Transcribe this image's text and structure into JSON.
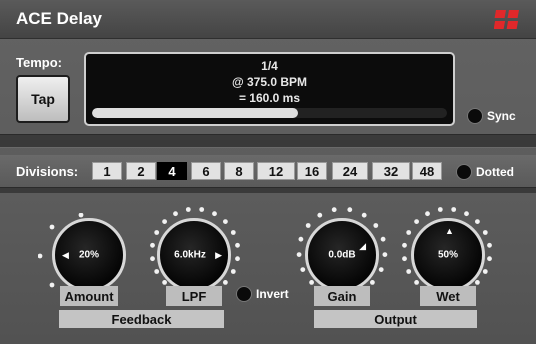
{
  "app": {
    "title": "ACE Delay"
  },
  "tempo": {
    "label": "Tempo:",
    "tap_label": "Tap",
    "display_line1": "1/4",
    "display_line2": "@ 375.0  BPM",
    "display_line3": "= 160.0 ms",
    "progress_fraction": 0.58,
    "sync_label": "Sync"
  },
  "divisions": {
    "label": "Divisions:",
    "options": [
      "1",
      "2",
      "4",
      "6",
      "8",
      "12",
      "16",
      "24",
      "32",
      "48"
    ],
    "selected": "4",
    "dotted_label": "Dotted"
  },
  "knobs": {
    "amount": {
      "label": "Amount",
      "value": "20%"
    },
    "lpf": {
      "label": "LPF",
      "value": "6.0kHz"
    },
    "gain": {
      "label": "Gain",
      "value": "0.0dB"
    },
    "wet": {
      "label": "Wet",
      "value": "50%"
    }
  },
  "invert_label": "Invert",
  "groups": {
    "feedback": "Feedback",
    "output": "Output"
  },
  "colors": {
    "logo": "#e0282a",
    "background": "#5b5b5b",
    "display": "#0c0c0c"
  }
}
